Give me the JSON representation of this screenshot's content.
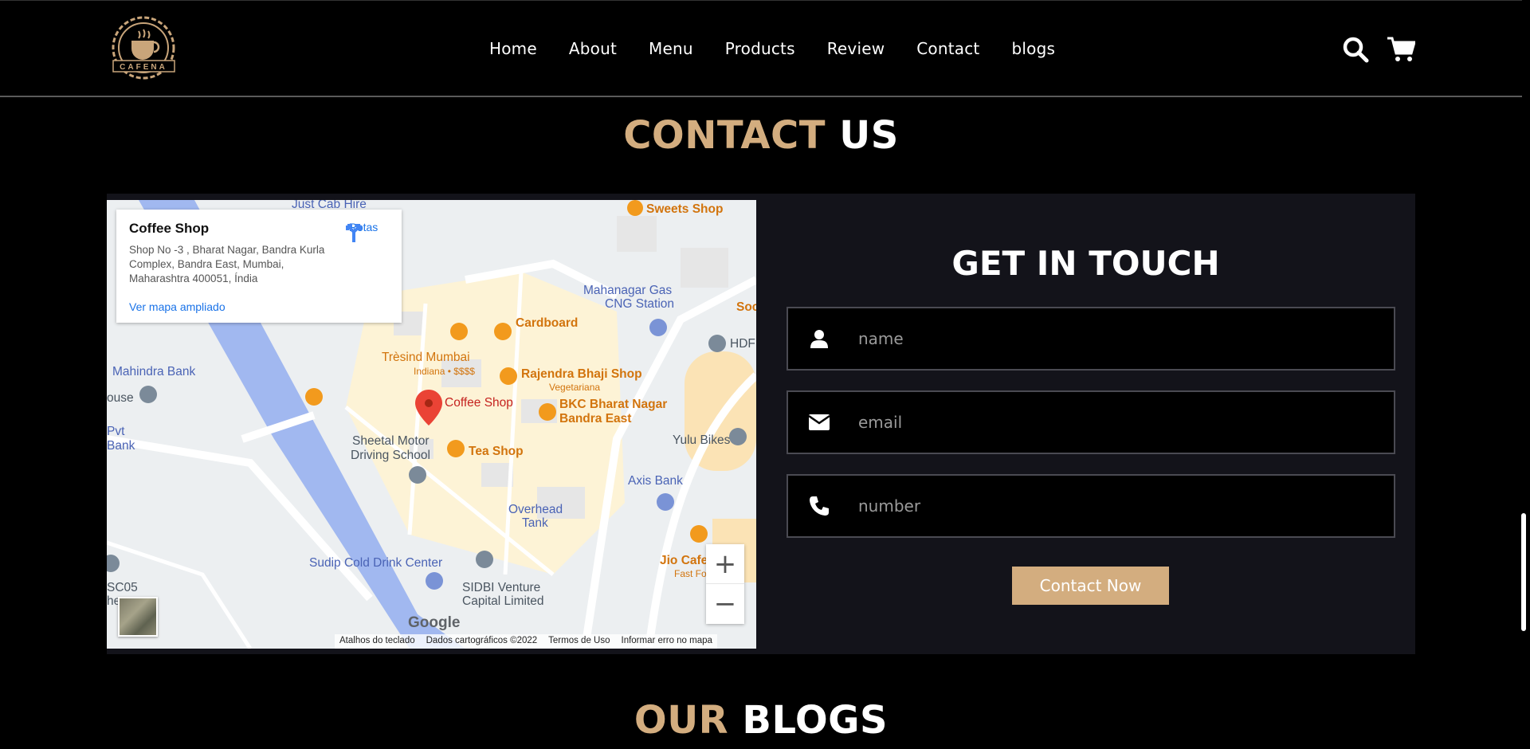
{
  "brand": {
    "logo_text": "CAFENA"
  },
  "nav": [
    "Home",
    "About",
    "Menu",
    "Products",
    "Review",
    "Contact",
    "blogs"
  ],
  "header_icons": [
    "search-icon",
    "cart-icon"
  ],
  "contact_section": {
    "title_accent": "CONTACT",
    "title_rest": "US"
  },
  "map": {
    "card": {
      "title": "Coffee Shop",
      "address": "Shop No -3 , Bharat Nagar, Bandra Kurla Complex, Bandra East, Mumbai, Maharashtra 400051, Índia",
      "link": "Ver mapa ampliado",
      "directions": "Rotas"
    },
    "labels": {
      "just_cab": "Just Cab Hire",
      "sweets": "Sweets Shop",
      "mahanagar": "Mahanagar Gas",
      "cng": "CNG Station",
      "soc": "Soc",
      "cardboard": "Cardboard",
      "hdf": "HDF",
      "tresind": "Trèsind Mumbai",
      "tresind_sub": "Indiana • $$$$",
      "rajendra": "Rajendra Bhaji Shop",
      "rajendra_sub": "Vegetariana",
      "mahindra": "Mahindra Bank",
      "ouse": "ouse",
      "coffee": "Coffee Shop",
      "bkc1": "BKC Bharat Nagar",
      "bkc2": "Bandra East",
      "pvt": "Pvt",
      "bank": "Bank",
      "sheetal1": "Sheetal Motor",
      "sheetal2": "Driving School",
      "tea": "Tea Shop",
      "yulu": "Yulu Bikes",
      "axis": "Axis Bank",
      "overhead1": "Overhead",
      "overhead2": "Tank",
      "jio": "Jio Cafe",
      "jio_sub": "Fast Fo",
      "sudip": "Sudip Cold Drink Center",
      "sidbi1": "SIDBI Venture",
      "sidbi2": "Capital Limited",
      "sc05": "SC05",
      "he": "he"
    },
    "google": "Google",
    "footer": [
      "Atalhos do teclado",
      "Dados cartográficos ©2022",
      "Termos de Uso",
      "Informar erro no mapa"
    ],
    "zoom_in": "+",
    "zoom_out": "−"
  },
  "form": {
    "title": "GET IN TOUCH",
    "fields": [
      {
        "icon": "user-icon",
        "placeholder": "name"
      },
      {
        "icon": "envelope-icon",
        "placeholder": "email"
      },
      {
        "icon": "phone-icon",
        "placeholder": "number"
      }
    ],
    "button": "Contact Now"
  },
  "blogs_section": {
    "title_accent": "OUR",
    "title_rest": "BLOGS"
  },
  "colors": {
    "accent": "#d3ad7f",
    "panel": "#13131a",
    "background": "#000000"
  }
}
